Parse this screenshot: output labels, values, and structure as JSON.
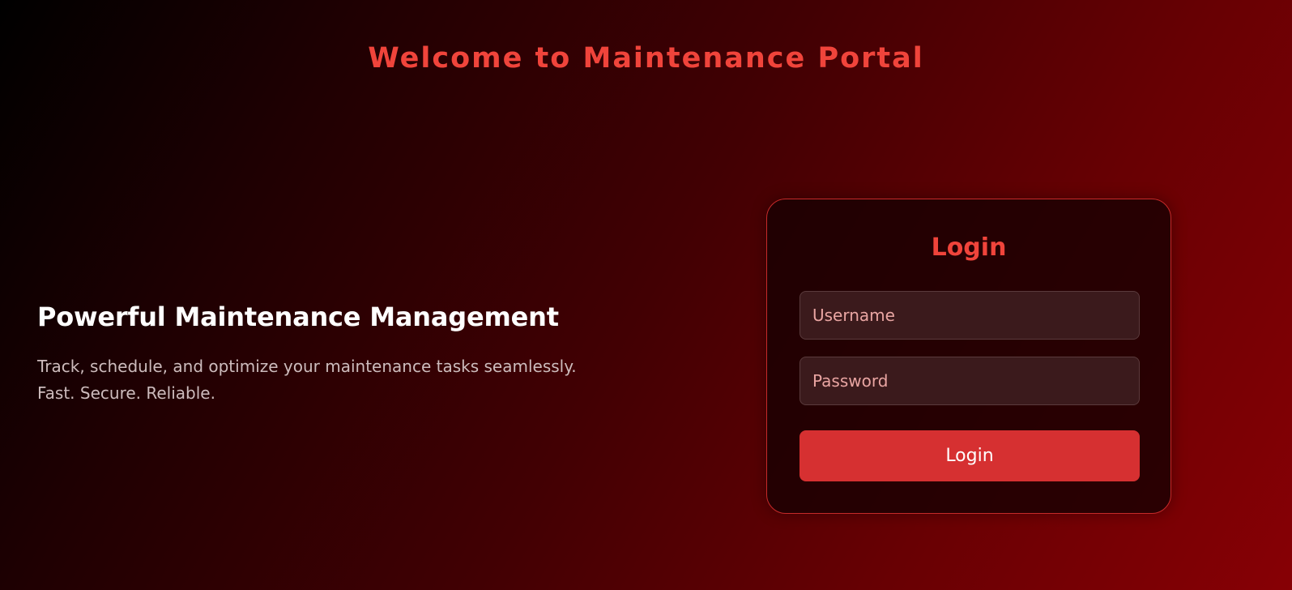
{
  "header": {
    "title": "Welcome to Maintenance Portal"
  },
  "hero": {
    "title": "Powerful Maintenance Management",
    "description_line1": "Track, schedule, and optimize your maintenance tasks seamlessly.",
    "description_line2": "Fast. Secure. Reliable."
  },
  "login": {
    "title": "Login",
    "username": {
      "value": "",
      "placeholder": "Username"
    },
    "password": {
      "value": "",
      "placeholder": "Password"
    },
    "submit_label": "Login"
  },
  "colors": {
    "accent": "#f0443b",
    "button": "#d63031",
    "card_border": "#c62a2a",
    "background_start": "#000000",
    "background_end": "#870005"
  }
}
